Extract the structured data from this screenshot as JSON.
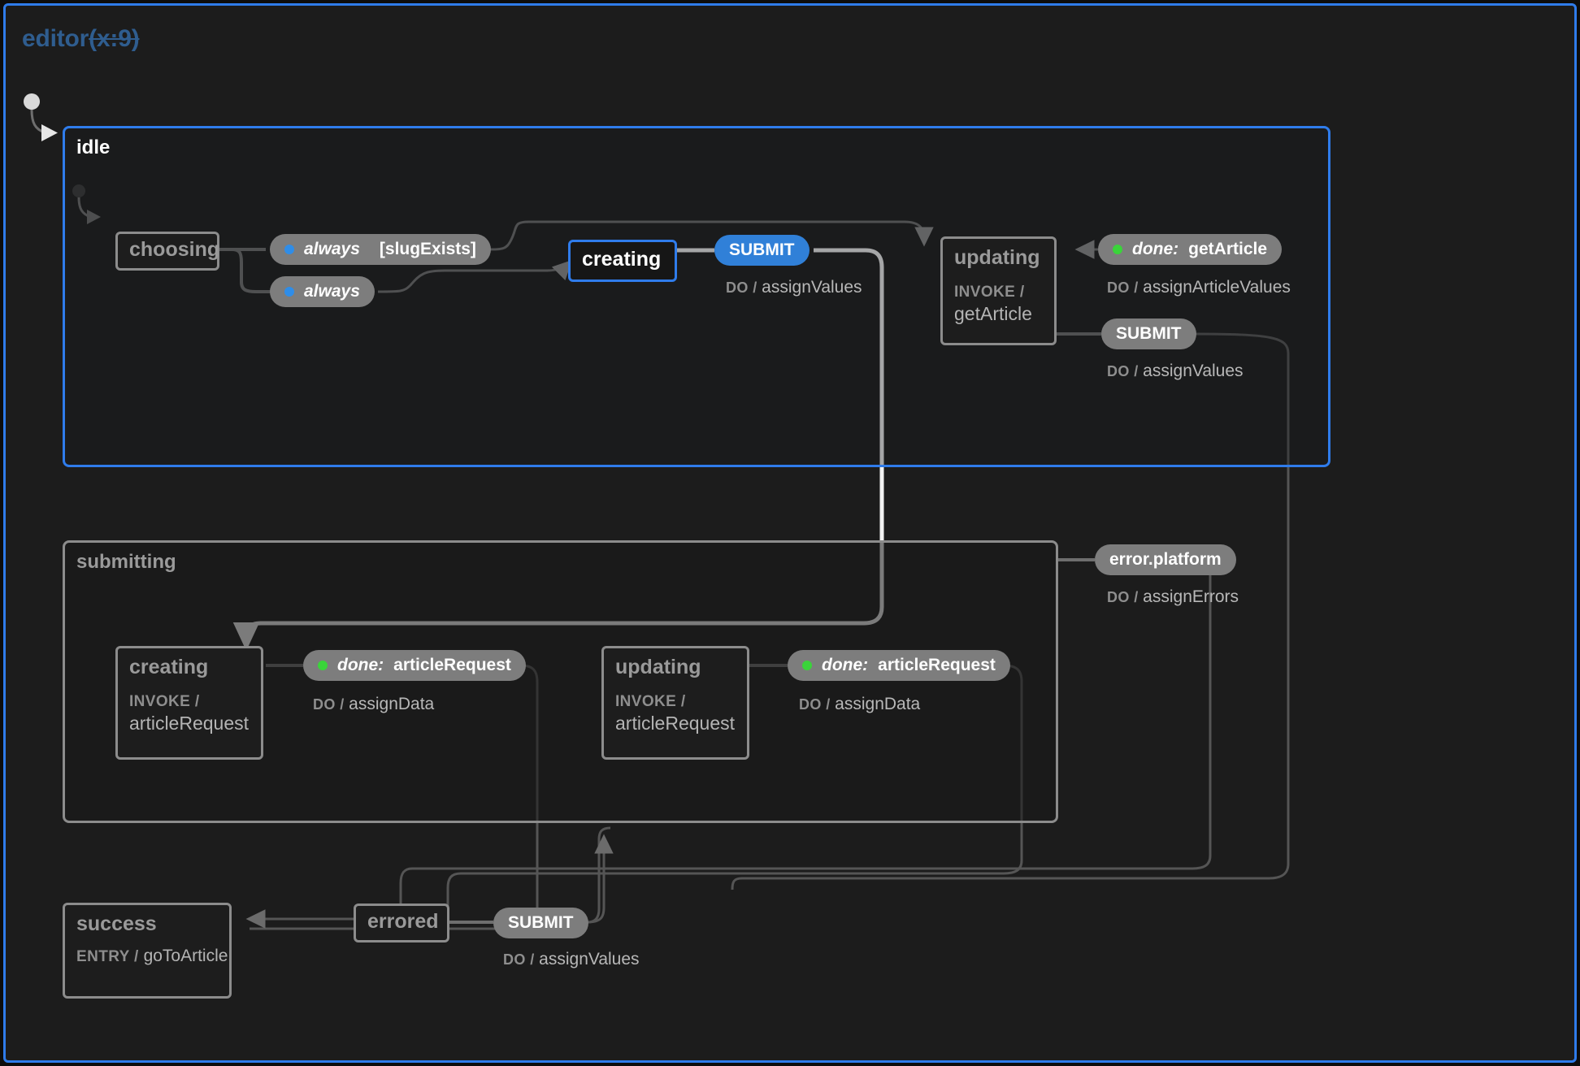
{
  "machine": {
    "name": "editor",
    "context_badge": "(x:9)",
    "accent_color": "#2f7ceb",
    "background": "#1c1c1c"
  },
  "states": {
    "idle": {
      "label": "idle",
      "active": true,
      "children": {
        "choosing": {
          "label": "choosing",
          "active": false
        },
        "creating": {
          "label": "creating",
          "active": true
        },
        "updating": {
          "label": "updating",
          "active": false,
          "invoke_keyword": "INVOKE /",
          "invoke_src": "getArticle"
        }
      }
    },
    "submitting": {
      "label": "submitting",
      "active": false,
      "children": {
        "creating": {
          "label": "creating",
          "active": false,
          "invoke_keyword": "INVOKE /",
          "invoke_src": "articleRequest"
        },
        "updating": {
          "label": "updating",
          "active": false,
          "invoke_keyword": "INVOKE /",
          "invoke_src": "articleRequest"
        }
      }
    },
    "success": {
      "label": "success",
      "active": false,
      "entry_keyword": "ENTRY /",
      "entry_action": "goToArticle"
    },
    "errored": {
      "label": "errored",
      "active": false
    }
  },
  "transitions": {
    "choosing_slug_exists": {
      "event": "always",
      "guard": "[slugExists]",
      "dot": "blue",
      "accent": false
    },
    "choosing_default": {
      "event": "always",
      "guard": "",
      "dot": "blue",
      "accent": false
    },
    "idle_creating_submit": {
      "event": "SUBMIT",
      "dot": "none",
      "accent": true,
      "action_keyword": "DO /",
      "action": "assignValues"
    },
    "updating_done_getarticle": {
      "event_prefix": "done:",
      "event": "getArticle",
      "dot": "green",
      "accent": false,
      "action_keyword": "DO /",
      "action": "assignArticleValues"
    },
    "idle_updating_submit": {
      "event": "SUBMIT",
      "dot": "none",
      "accent": false,
      "action_keyword": "DO /",
      "action": "assignValues"
    },
    "submitting_creating_done": {
      "event_prefix": "done:",
      "event": "articleRequest",
      "dot": "green",
      "accent": false,
      "action_keyword": "DO /",
      "action": "assignData"
    },
    "submitting_updating_done": {
      "event_prefix": "done:",
      "event": "articleRequest",
      "dot": "green",
      "accent": false,
      "action_keyword": "DO /",
      "action": "assignData"
    },
    "submitting_error": {
      "event": "error.platform",
      "dot": "none",
      "accent": false,
      "action_keyword": "DO /",
      "action": "assignErrors"
    },
    "errored_submit": {
      "event": "SUBMIT",
      "dot": "none",
      "accent": false,
      "action_keyword": "DO /",
      "action": "assignValues"
    }
  }
}
